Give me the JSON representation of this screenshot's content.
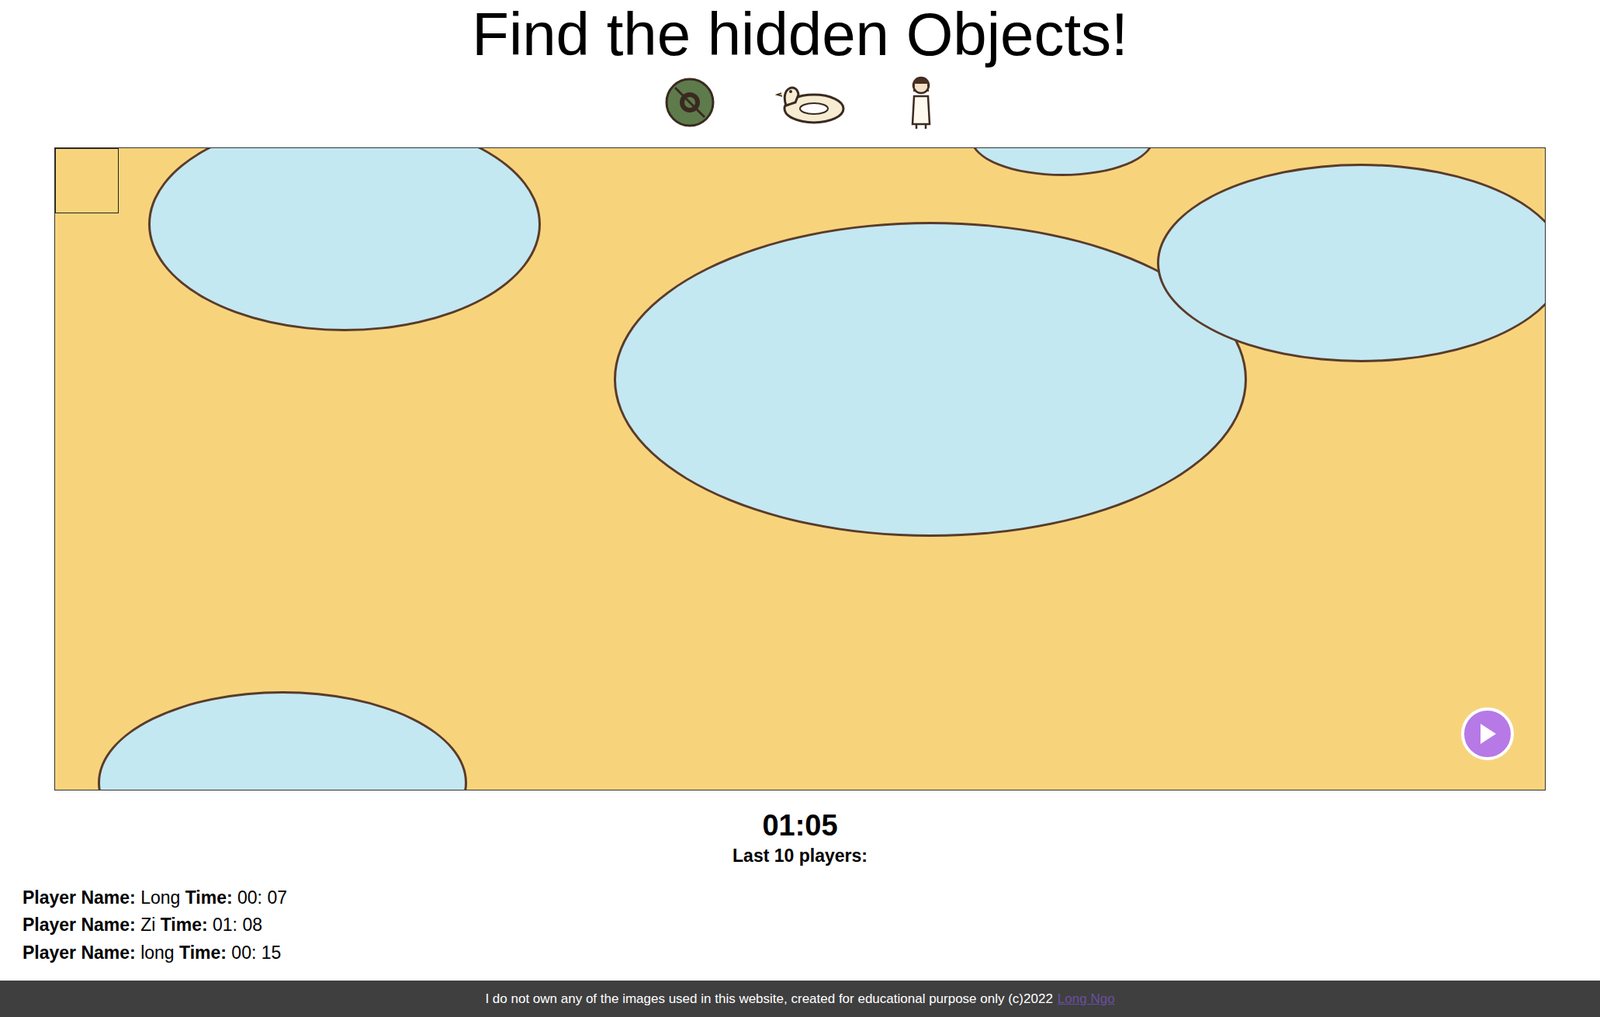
{
  "title": "Find the hidden Objects!",
  "timer": "01:05",
  "leaderboard": {
    "heading": "Last 10 players:",
    "rows": [
      {
        "name_label": "Player Name:",
        "name": "Long",
        "time_label": "Time:",
        "time": "00: 07"
      },
      {
        "name_label": "Player Name:",
        "name": "Zi",
        "time_label": "Time:",
        "time": "01: 08"
      },
      {
        "name_label": "Player Name:",
        "name": "long",
        "time_label": "Time:",
        "time": "00: 15"
      }
    ]
  },
  "footer": {
    "text": "I do not own any of the images used in this website, created for educational purpose only (c)2022",
    "link": "Long Ngo"
  }
}
